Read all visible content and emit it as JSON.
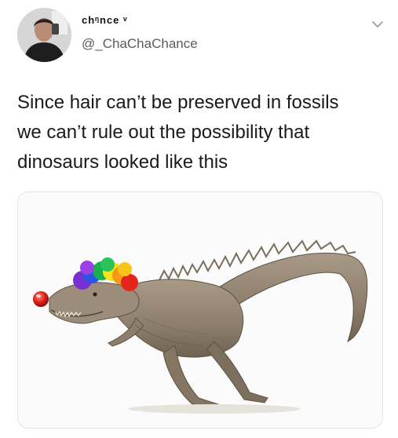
{
  "user": {
    "display_name": "chᵑnce ᵛ",
    "handle": "@_ChaChaChance"
  },
  "tweet": {
    "lines": [
      "Since hair can’t be preserved in fossils",
      "we can’t rule out the possibility that",
      "dinosaurs looked like this"
    ]
  },
  "icons": {
    "menu": "chevron-down-icon"
  }
}
